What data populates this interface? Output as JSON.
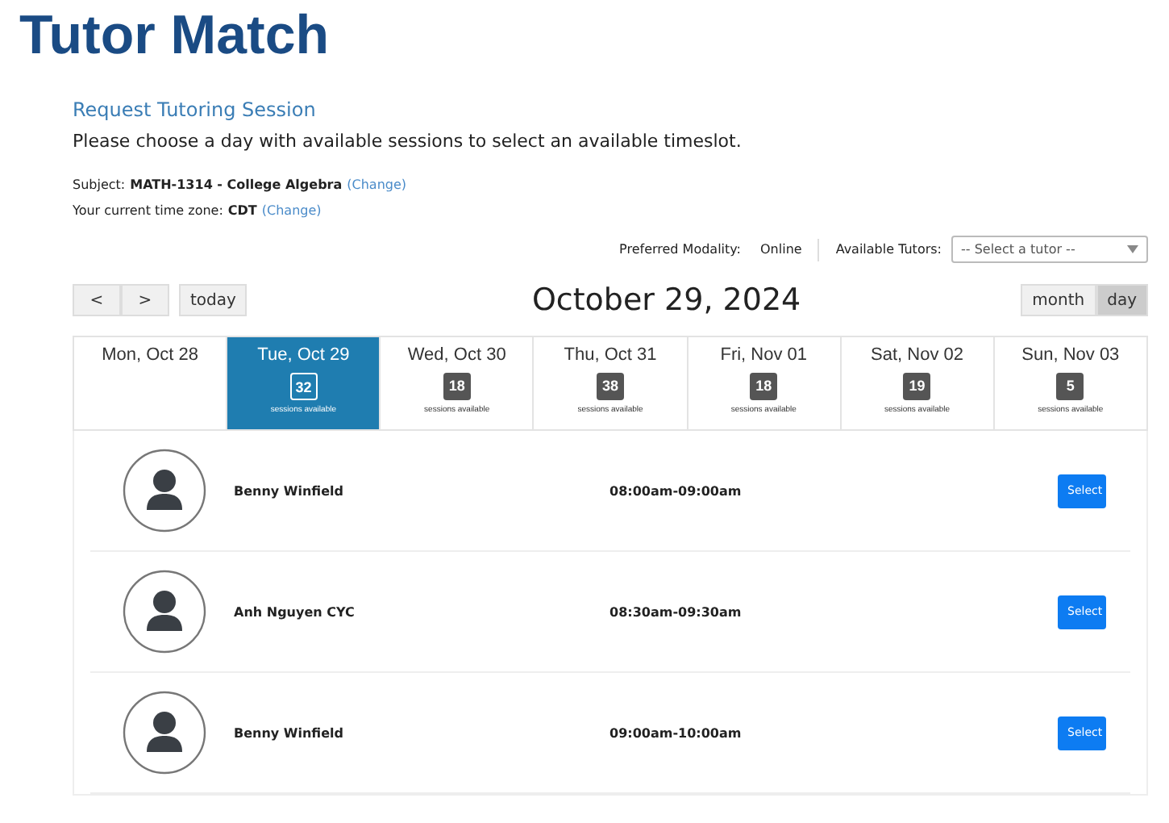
{
  "title": "Tutor Match",
  "heading": "Request Tutoring Session",
  "instructions": "Please choose a day with available sessions to select an available timeslot.",
  "subject": {
    "label": "Subject:",
    "value": "MATH-1314 - College Algebra",
    "link": "(Change)"
  },
  "timezone": {
    "label": "Your current time zone:",
    "value": "CDT",
    "link": "(Change)"
  },
  "modality": {
    "label": "Preferred Modality:",
    "value": "Online"
  },
  "tutors": {
    "label": "Available Tutors:",
    "placeholder": "-- Select a tutor --"
  },
  "nav": {
    "prev": "<",
    "next": ">",
    "today": "today"
  },
  "calendar_title": "October 29, 2024",
  "views": [
    {
      "label": "month",
      "selected": false
    },
    {
      "label": "day",
      "selected": true
    }
  ],
  "days": [
    {
      "label": "Mon, Oct 28",
      "selected": false
    },
    {
      "label": "Tue, Oct 29",
      "count": "32",
      "caption": "sessions available",
      "selected": true
    },
    {
      "label": "Wed, Oct 30",
      "count": "18",
      "caption": "sessions available",
      "selected": false
    },
    {
      "label": "Thu, Oct 31",
      "count": "38",
      "caption": "sessions available",
      "selected": false
    },
    {
      "label": "Fri, Nov 01",
      "count": "18",
      "caption": "sessions available",
      "selected": false
    },
    {
      "label": "Sat, Nov 02",
      "count": "19",
      "caption": "sessions available",
      "selected": false
    },
    {
      "label": "Sun, Nov 03",
      "count": "5",
      "caption": "sessions available",
      "selected": false
    }
  ],
  "sessions": [
    {
      "tutor": "Benny Winfield",
      "time": "08:00am-09:00am",
      "action": "Select"
    },
    {
      "tutor": "Anh Nguyen CYC",
      "time": "08:30am-09:30am",
      "action": "Select"
    },
    {
      "tutor": "Benny Winfield",
      "time": "09:00am-10:00am",
      "action": "Select"
    }
  ]
}
